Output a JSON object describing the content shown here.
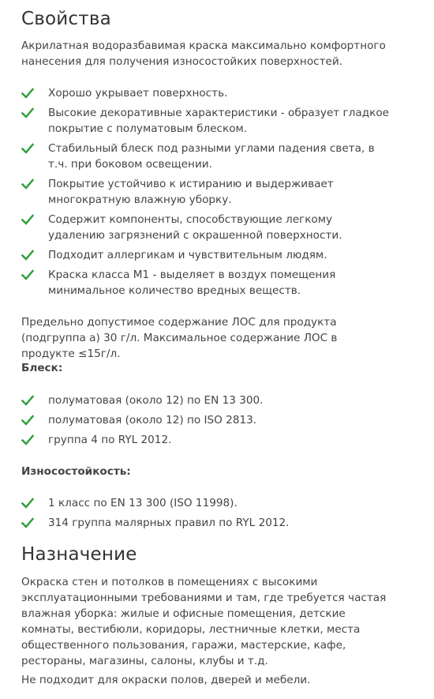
{
  "properties": {
    "title": "Свойства",
    "intro": "Акрилатная водоразбавимая краска максимально комфортного нанесения для получения износостойких поверхностей.",
    "items": [
      "Хорошо укрывает поверхность.",
      "Высокие декоративные характеристики - образует гладкое покрытие с полуматовым блеском.",
      "Стабильный блеск под разными углами падения света, в т.ч. при боковом освещении.",
      "Покрытие устойчиво к истиранию и выдерживает многократную влажную уборку.",
      "Содержит компоненты, способствующие легкому удалению загрязнений с окрашенной поверхности.",
      "Подходит аллергикам и чувствительным людям.",
      "Краска класса М1 - выделяет в воздух помещения минимальное количество вредных веществ."
    ],
    "voc_text": "Предельно допустимое содержание ЛОС для продукта (подгруппа а) 30 г/л. Максимальное содержание ЛОС в продукте ≤15г/л."
  },
  "gloss": {
    "heading": "Блеск:",
    "items": [
      "полуматовая  (около 12) по EN 13 300.",
      "полуматовая (около 12) по ISO 2813.",
      "группа 4 по RYL 2012."
    ]
  },
  "wear": {
    "heading": "Износостойкость:",
    "items": [
      "1 класс по EN 13 300 (ISO 11998).",
      "314 группа малярных правил по RYL 2012."
    ]
  },
  "purpose": {
    "title": "Назначение",
    "text": "Окраска стен и потолков в помещениях с высокими эксплуатационными требованиями и там, где требуется частая влажная уборка: жилые и офисные помещения, детские комнаты, вестибюли, коридоры, лестничные клетки, места общественного пользования, гаражи, мастерские, кафе, рестораны, магазины, салоны, клубы и т.д.",
    "note": "Не подходит для окраски полов, дверей и мебели."
  },
  "colors": {
    "check": "#2e9e3a",
    "text": "#444444",
    "heading": "#333333"
  },
  "icons": {
    "bullet": "check-icon"
  }
}
